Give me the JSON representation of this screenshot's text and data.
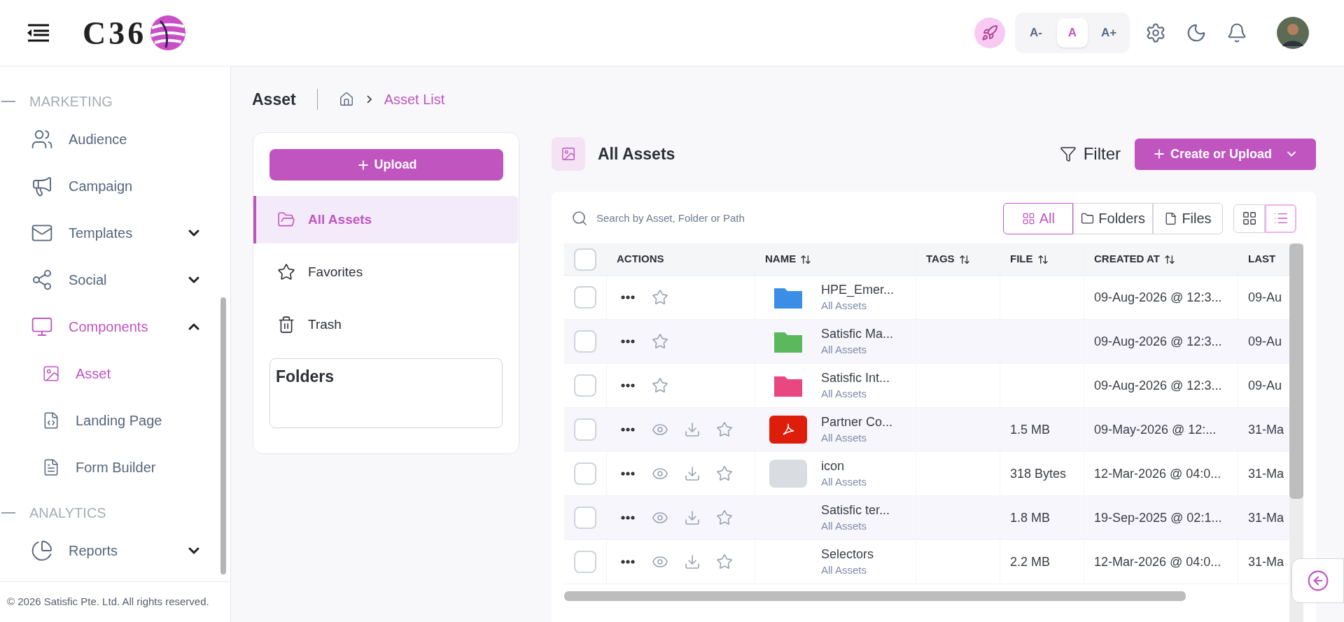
{
  "header": {
    "logo_text": "C36",
    "font_sizes": [
      {
        "label": "A-",
        "selected": false
      },
      {
        "label": "A",
        "selected": true
      },
      {
        "label": "A+",
        "selected": false
      }
    ]
  },
  "sidebar": {
    "sections": [
      {
        "title": "MARKETING",
        "items": [
          {
            "label": "Audience",
            "selected": false
          },
          {
            "label": "Campaign",
            "selected": false
          },
          {
            "label": "Templates",
            "selected": false,
            "expanded": false
          },
          {
            "label": "Social",
            "selected": false,
            "expanded": false
          },
          {
            "label": "Components",
            "selected": true,
            "expanded": true,
            "children": [
              {
                "label": "Asset",
                "selected": true
              },
              {
                "label": "Landing Page",
                "selected": false
              },
              {
                "label": "Form Builder",
                "selected": false
              }
            ]
          }
        ]
      },
      {
        "title": "ANALYTICS",
        "items": [
          {
            "label": "Reports",
            "selected": false,
            "expanded": false
          }
        ]
      }
    ],
    "footer": "© 2026 Satisfic Pte. Ltd. All rights reserved."
  },
  "page": {
    "title": "Asset",
    "breadcrumb": "Asset List"
  },
  "left_panel": {
    "upload_button": "Upload",
    "nav": [
      {
        "label": "All Assets",
        "selected": true
      },
      {
        "label": "Favorites",
        "selected": false
      },
      {
        "label": "Trash",
        "selected": false
      }
    ],
    "folders_title": "Folders"
  },
  "content": {
    "title": "All Assets",
    "filter_button": "Filter",
    "create_button": "Create or Upload",
    "search": {
      "placeholder": "Search by Asset, Folder or Path"
    },
    "type_tabs": [
      {
        "label": "All",
        "selected": true
      },
      {
        "label": "Folders",
        "selected": false
      },
      {
        "label": "Files",
        "selected": false
      }
    ],
    "view_toggles": [
      {
        "selected": false
      },
      {
        "selected": true
      }
    ],
    "table": {
      "header_checked": false,
      "columns": [
        {
          "label": "ACTIONS",
          "sortable": false
        },
        {
          "label": "NAME",
          "sortable": true
        },
        {
          "label": "TAGS",
          "sortable": true
        },
        {
          "label": "FILE",
          "sortable": true
        },
        {
          "label": "CREATED AT",
          "sortable": true
        },
        {
          "label": "LAST",
          "sortable": false
        }
      ],
      "rows": [
        {
          "checked": false,
          "kind": "folder",
          "color": "#3a8ee6",
          "name": "HPE_Emer...",
          "location": "All Assets",
          "created": "09-Aug-2026 @ 12:3...",
          "column_7": "09-Au"
        },
        {
          "checked": false,
          "kind": "folder",
          "color": "#5cb85c",
          "name": "Satisfic Ma...",
          "location": "All Assets",
          "created": "09-Aug-2026 @ 12:3...",
          "column_7": "09-Au"
        },
        {
          "checked": false,
          "kind": "folder",
          "color": "#e8487f",
          "name": "Satisfic Int...",
          "location": "All Assets",
          "created": "09-Aug-2026 @ 12:3...",
          "column_7": "09-Au"
        },
        {
          "checked": false,
          "kind": "pdf",
          "name": "Partner Co...",
          "location": "All Assets",
          "file": "1.5 MB",
          "created": "09-May-2026 @ 12:...",
          "column_7": "31-Ma"
        },
        {
          "checked": false,
          "kind": "image",
          "name": "icon",
          "location": "All Assets",
          "file": "318 Bytes",
          "created": "12-Mar-2026 @ 04:0...",
          "column_7": "31-Ma"
        },
        {
          "checked": false,
          "kind": "document",
          "name": "Satisfic ter...",
          "location": "All Assets",
          "file": "1.8 MB",
          "created": "19-Sep-2025 @ 02:1...",
          "column_7": "31-Ma"
        },
        {
          "checked": false,
          "kind": "document",
          "name": "Selectors",
          "location": "All Assets",
          "file": "2.2 MB",
          "created": "12-Mar-2026 @ 04:0...",
          "column_7": "31-Ma"
        }
      ]
    }
  }
}
